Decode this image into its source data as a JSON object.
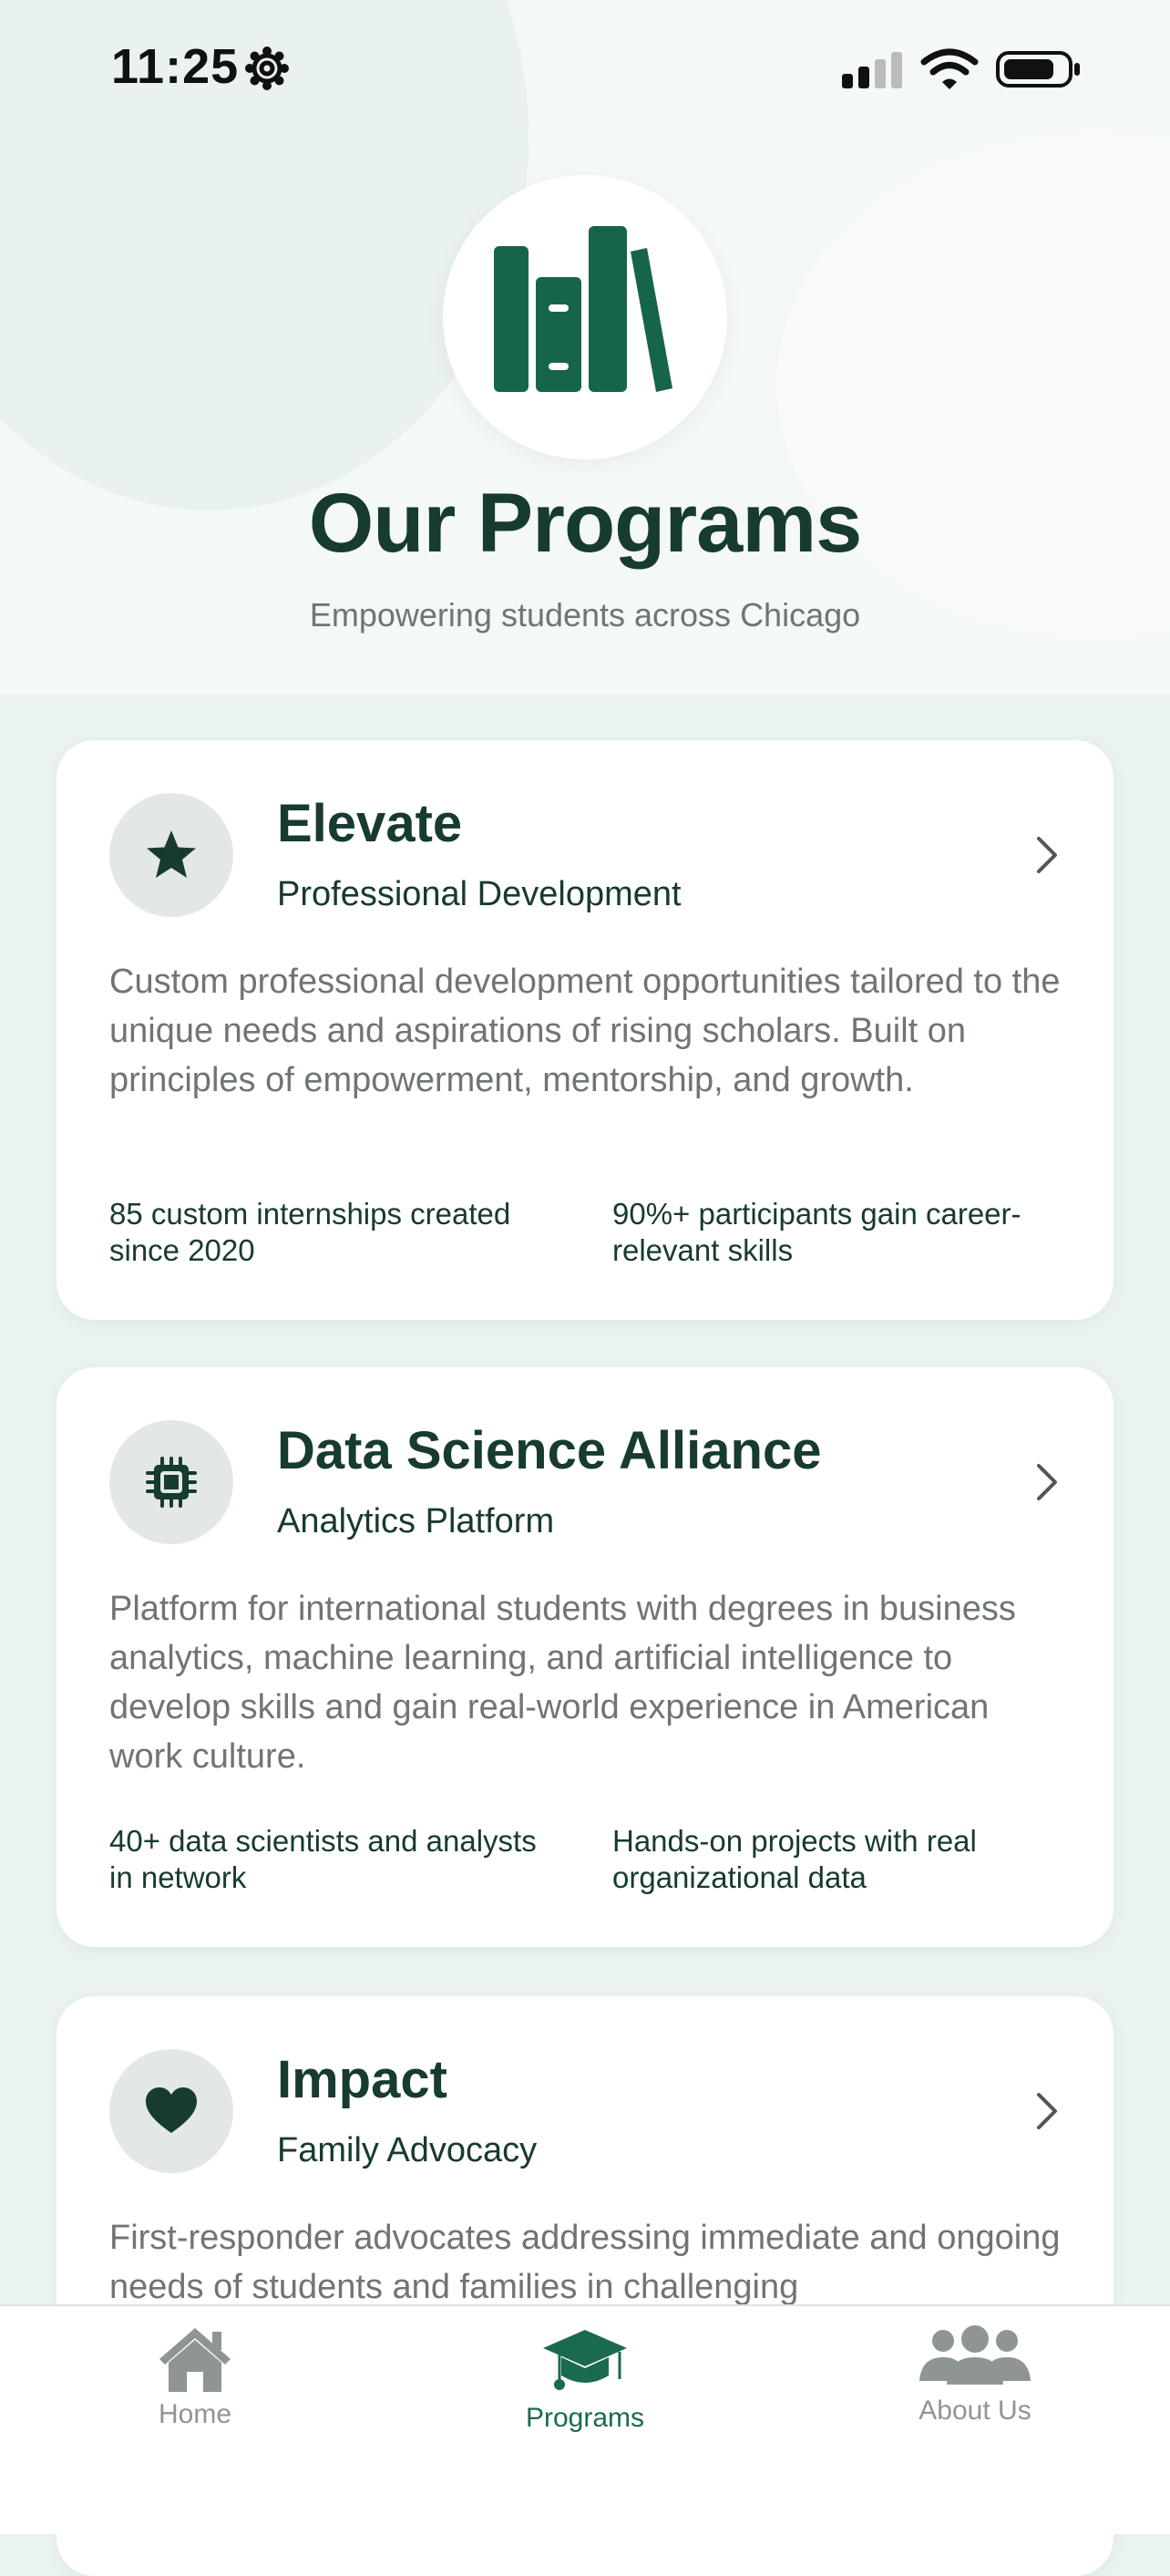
{
  "status_bar": {
    "time": "11:25"
  },
  "header": {
    "title": "Our Programs",
    "subtitle": "Empowering students across Chicago",
    "logo_icon": "books-icon"
  },
  "programs": [
    {
      "icon": "star-icon",
      "title": "Elevate",
      "subtitle": "Professional Development",
      "description": "Custom professional development opportunities tailored to the unique needs and aspirations of rising scholars. Built on principles of empowerment, mentorship, and growth.",
      "stat_left": "85 custom internships created since 2020",
      "stat_right": "90%+ participants gain career-relevant skills"
    },
    {
      "icon": "chip-icon",
      "title": "Data Science Alliance",
      "subtitle": "Analytics Platform",
      "description": "Platform for international students with degrees in business analytics, machine learning, and artificial intelligence to develop skills and gain real-world experience in American work culture.",
      "stat_left": "40+ data scientists and analysts in network",
      "stat_right": "Hands-on projects with real organizational data"
    },
    {
      "icon": "heart-icon",
      "title": "Impact",
      "subtitle": "Family Advocacy",
      "description": "First-responder advocates addressing immediate and ongoing needs of students and families in challenging"
    }
  ],
  "tab_bar": {
    "tabs": [
      {
        "label": "Home",
        "icon": "house-icon",
        "active": false
      },
      {
        "label": "Programs",
        "icon": "graduation-cap-icon",
        "active": true
      },
      {
        "label": "About Us",
        "icon": "people-icon",
        "active": false
      }
    ]
  },
  "colors": {
    "accent": "#1a6a4e",
    "title_text": "#173a31",
    "body_text": "#6f7572",
    "background": "#ebf3ef"
  }
}
